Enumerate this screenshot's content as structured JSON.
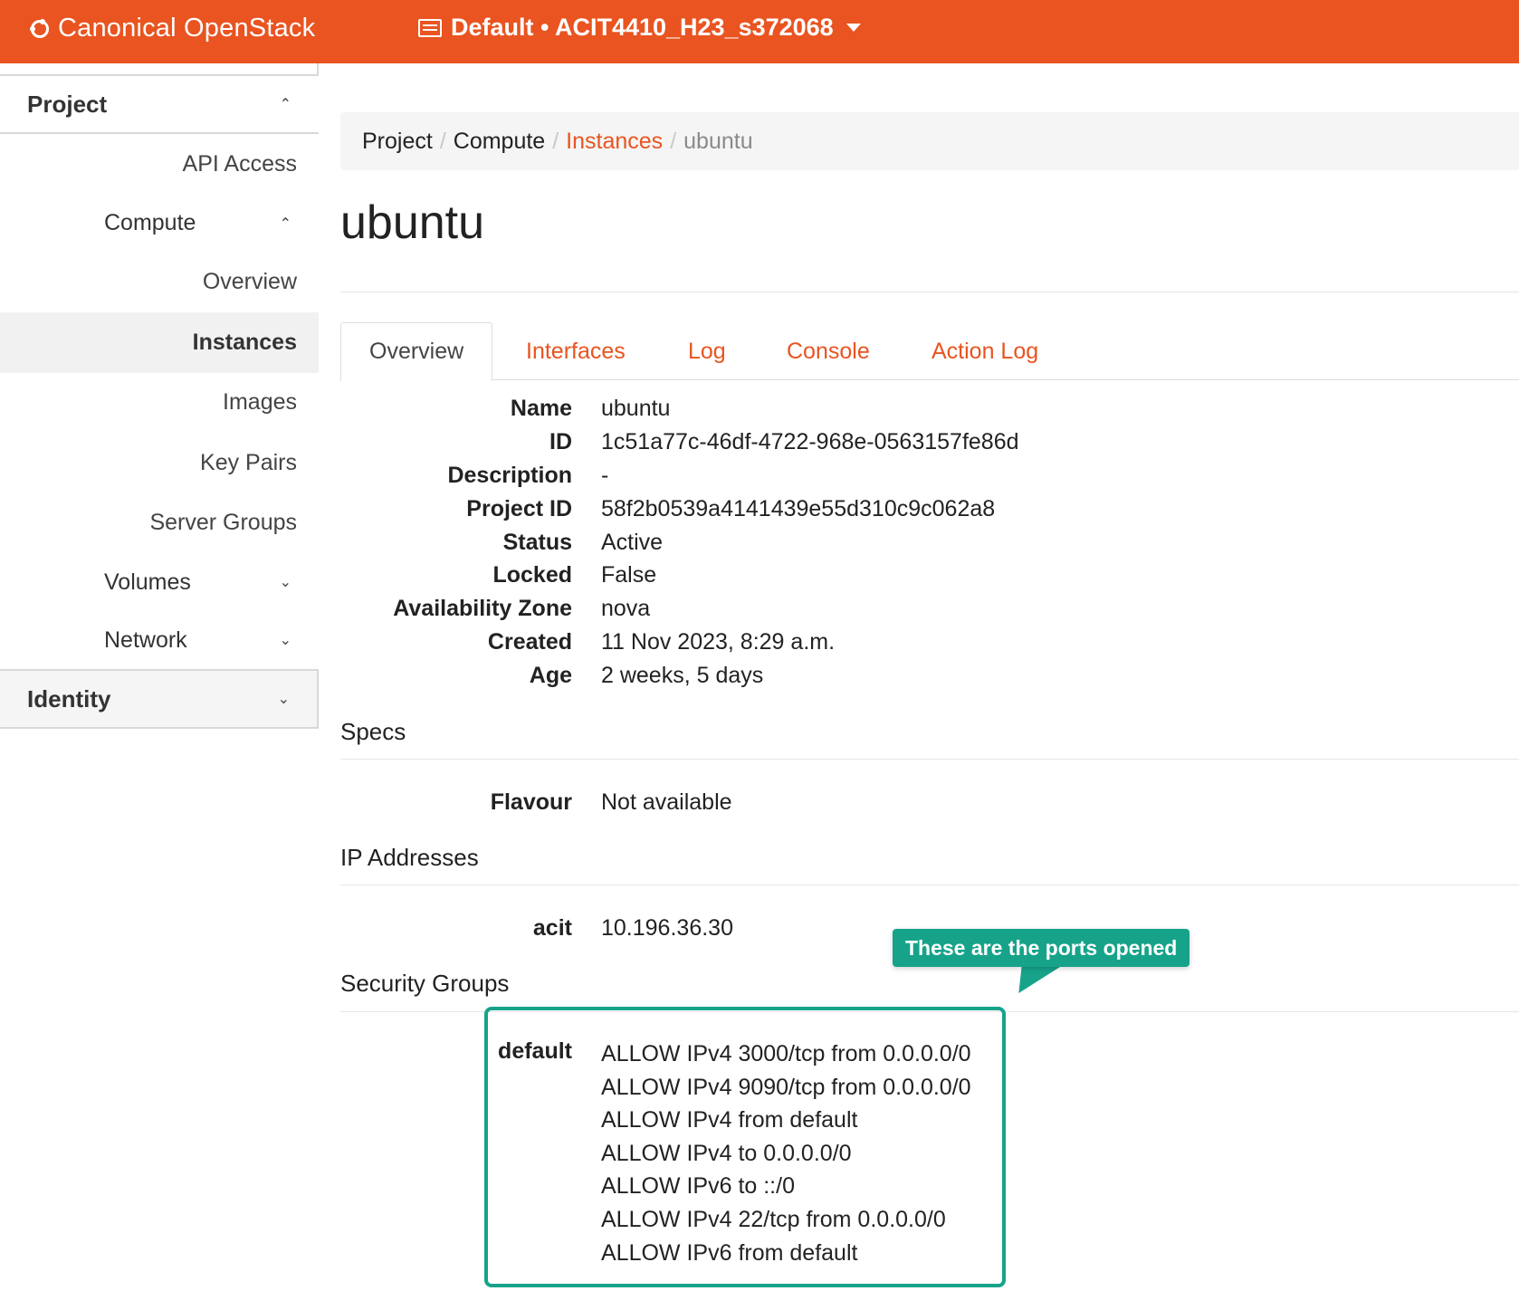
{
  "topbar": {
    "brand": "Canonical OpenStack",
    "project_selector": "Default • ACIT4410_H23_s372068"
  },
  "sidebar": {
    "project_label": "Project",
    "items": [
      {
        "label": "API Access"
      },
      {
        "label": "Compute"
      },
      {
        "label": "Overview"
      },
      {
        "label": "Instances"
      },
      {
        "label": "Images"
      },
      {
        "label": "Key Pairs"
      },
      {
        "label": "Server Groups"
      },
      {
        "label": "Volumes"
      },
      {
        "label": "Network"
      }
    ],
    "identity_label": "Identity"
  },
  "breadcrumb": {
    "project": "Project",
    "compute": "Compute",
    "instances": "Instances",
    "current": "ubuntu",
    "separator": "/"
  },
  "page": {
    "title": "ubuntu"
  },
  "tabs": [
    {
      "label": "Overview"
    },
    {
      "label": "Interfaces"
    },
    {
      "label": "Log"
    },
    {
      "label": "Console"
    },
    {
      "label": "Action Log"
    }
  ],
  "overview": [
    {
      "key": "Name",
      "value": "ubuntu"
    },
    {
      "key": "ID",
      "value": "1c51a77c-46df-4722-968e-0563157fe86d"
    },
    {
      "key": "Description",
      "value": "-"
    },
    {
      "key": "Project ID",
      "value": "58f2b0539a4141439e55d310c9c062a8"
    },
    {
      "key": "Status",
      "value": "Active"
    },
    {
      "key": "Locked",
      "value": "False"
    },
    {
      "key": "Availability Zone",
      "value": "nova"
    },
    {
      "key": "Created",
      "value": "11 Nov 2023, 8:29 a.m."
    },
    {
      "key": "Age",
      "value": "2 weeks, 5 days"
    }
  ],
  "specs": {
    "heading": "Specs",
    "flavour_key": "Flavour",
    "flavour_value": "Not available"
  },
  "ip_addresses": {
    "heading": "IP Addresses",
    "network_key": "acit",
    "network_value": "10.196.36.30"
  },
  "security_groups": {
    "heading": "Security Groups",
    "group_key": "default",
    "rules": [
      "ALLOW IPv4 3000/tcp from 0.0.0.0/0",
      "ALLOW IPv4 9090/tcp from 0.0.0.0/0",
      "ALLOW IPv4 from default",
      "ALLOW IPv4 to 0.0.0.0/0",
      "ALLOW IPv6 to ::/0",
      "ALLOW IPv4 22/tcp from 0.0.0.0/0",
      "ALLOW IPv6 from default"
    ]
  },
  "annotation": {
    "callout_text": "These are the ports opened"
  },
  "colors": {
    "accent": "#e95420",
    "callout": "#16a38a"
  },
  "icons": {
    "brand": "openstack-logo-icon",
    "project_selector": "list-icon",
    "dropdown": "caret-down-icon",
    "expand": "chevron-up-icon",
    "collapse": "chevron-down-icon"
  }
}
